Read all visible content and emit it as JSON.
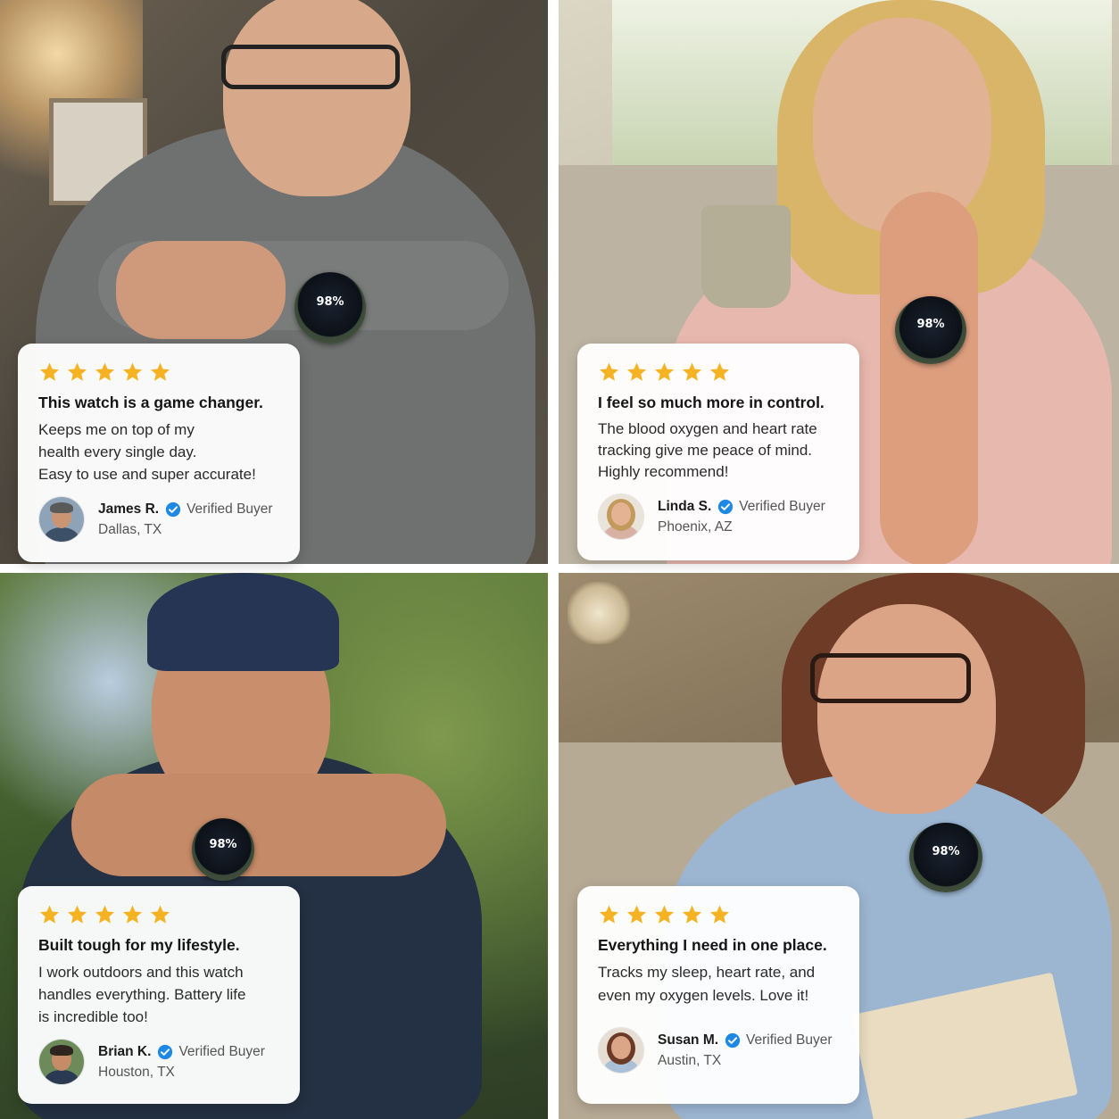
{
  "colors": {
    "star": "#f5b324",
    "verified": "#1e88e5",
    "card_background": "#ffffff",
    "watch_band": "#4e5b48"
  },
  "reviews": [
    {
      "rating": 5,
      "headline": "This watch is a game changer.",
      "body": [
        "Keeps me on top of my",
        "health every single day.",
        "Easy to use and super accurate!"
      ],
      "name": "James R.",
      "badge": "Verified Buyer",
      "location": "Dallas, TX",
      "avatar_icon": "man-avatar-icon",
      "watch_reading": "98%"
    },
    {
      "rating": 5,
      "headline": "I feel so much more in control.",
      "body": [
        "The blood oxygen and heart rate",
        "tracking give me peace of mind.",
        "Highly recommend!"
      ],
      "name": "Linda S.",
      "badge": "Verified Buyer",
      "location": "Phoenix, AZ",
      "avatar_icon": "woman-avatar-icon",
      "watch_reading": "98%"
    },
    {
      "rating": 5,
      "headline": "Built tough for my lifestyle.",
      "body": [
        "I work outdoors and this watch",
        "handles everything. Battery life",
        "is incredible too!"
      ],
      "name": "Brian K.",
      "badge": "Verified Buyer",
      "location": "Houston, TX",
      "avatar_icon": "man-avatar-icon",
      "watch_reading": "98%"
    },
    {
      "rating": 5,
      "headline": "Everything I need in one place.",
      "body": [
        "Tracks my sleep, heart rate, and",
        "even my oxygen levels. Love it!"
      ],
      "name": "Susan M.",
      "badge": "Verified Buyer",
      "location": "Austin, TX",
      "avatar_icon": "woman-avatar-icon",
      "watch_reading": "98%"
    }
  ]
}
